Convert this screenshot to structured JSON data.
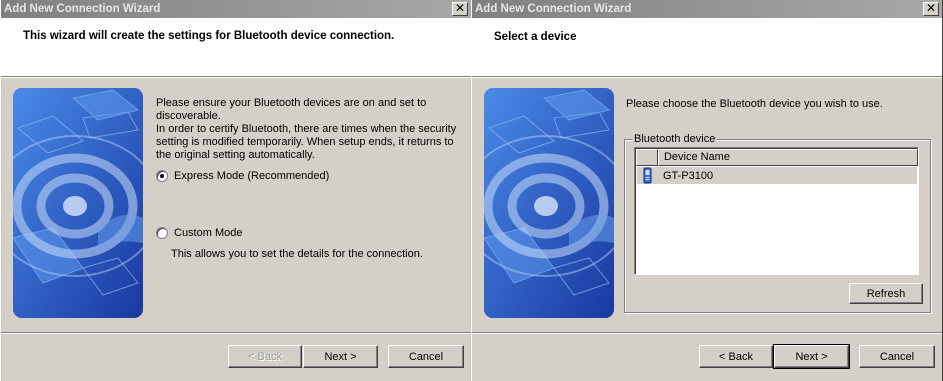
{
  "windows": [
    {
      "title": "Add New Connection Wizard",
      "close_glyph": "✕",
      "header": "This wizard will create the settings for Bluetooth device connection.",
      "intro_lines": [
        "Please ensure your Bluetooth devices are on and set to",
        "discoverable.",
        "In order to certify Bluetooth, there are times when the security",
        "setting is modified temporarily. When setup ends, it returns to",
        "the original setting automatically."
      ],
      "express_mode": "Express Mode (Recommended)",
      "custom_mode": "Custom Mode",
      "custom_desc": "This allows you to set the details for the connection.",
      "buttons": {
        "back": "< Back",
        "next": "Next >",
        "cancel": "Cancel"
      }
    },
    {
      "title": "Add New Connection Wizard",
      "close_glyph": "✕",
      "header": "Select a device",
      "prompt": "Please choose the Bluetooth device you wish to use.",
      "group_label": "Bluetooth device",
      "column_header": "Device Name",
      "devices": [
        {
          "name": "GT-P3100",
          "icon": "phone-icon"
        }
      ],
      "refresh": "Refresh",
      "buttons": {
        "back": "< Back",
        "next": "Next >",
        "cancel": "Cancel"
      }
    }
  ],
  "colors": {
    "dialog_face": "#d4d0c8",
    "titlebar_inactive": "#808080",
    "art_blue": "#2058c0"
  }
}
